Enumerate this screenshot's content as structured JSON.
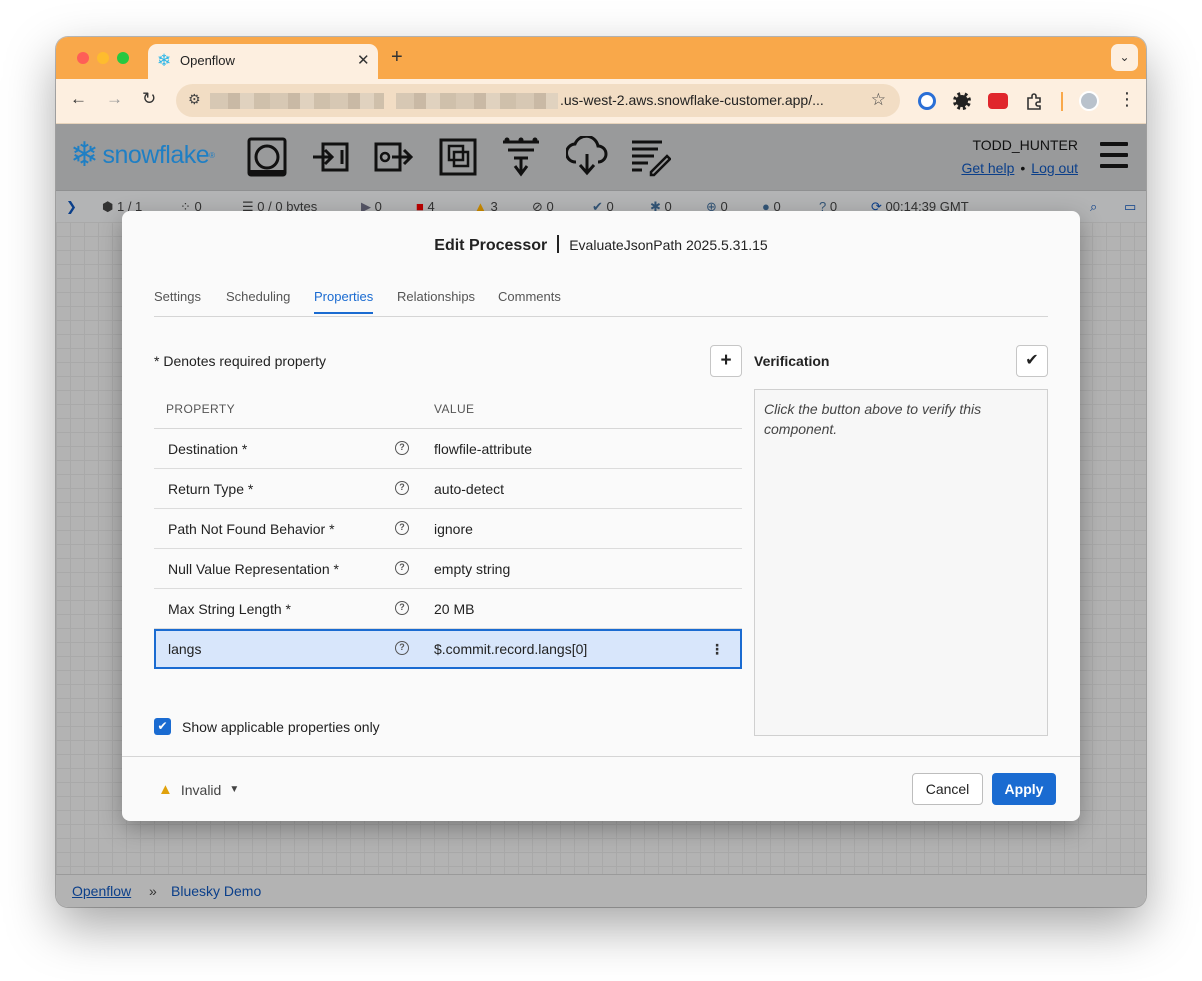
{
  "browser": {
    "tab_title": "Openflow",
    "url_visible": ".us-west-2.aws.snowflake-customer.app/..."
  },
  "header": {
    "brand": "snowflake",
    "user": "TODD_HUNTER",
    "help_link": "Get help",
    "logout_link": "Log out",
    "toolbar_icons": [
      "processor-icon",
      "input-port-icon",
      "output-port-icon",
      "process-group-icon",
      "remote-process-group-icon",
      "funnel-icon",
      "label-icon"
    ]
  },
  "statusbar": {
    "process_groups": "1 / 1",
    "clustering": "0",
    "queued": "0 / 0 bytes",
    "running": "0",
    "stopped": "4",
    "invalid": "3",
    "disabled": "0",
    "up_to_date": "0",
    "locally_modified": "0",
    "stale": "0",
    "errors": "0",
    "sync_failure": "0",
    "last_refresh": "00:14:39 GMT"
  },
  "breadcrumb": {
    "root": "Openflow",
    "separator": "»",
    "current": "Bluesky Demo"
  },
  "dialog": {
    "title": "Edit Processor",
    "subtitle": "EvaluateJsonPath 2025.5.31.15",
    "tabs": [
      "Settings",
      "Scheduling",
      "Properties",
      "Relationships",
      "Comments"
    ],
    "required_note": "* Denotes required property",
    "columns": {
      "property": "PROPERTY",
      "value": "VALUE"
    },
    "properties": [
      {
        "name": "Destination *",
        "value": "flowfile-attribute"
      },
      {
        "name": "Return Type *",
        "value": "auto-detect"
      },
      {
        "name": "Path Not Found Behavior *",
        "value": "ignore"
      },
      {
        "name": "Null Value Representation *",
        "value": "empty string"
      },
      {
        "name": "Max String Length *",
        "value": "20 MB"
      },
      {
        "name": "langs",
        "value": "$.commit.record.langs[0]"
      }
    ],
    "show_applicable": "Show applicable properties only",
    "verification": {
      "title": "Verification",
      "hint": "Click the button above to verify this component."
    },
    "status": "Invalid",
    "cancel": "Cancel",
    "apply": "Apply",
    "accent": "#1a6bd1"
  }
}
